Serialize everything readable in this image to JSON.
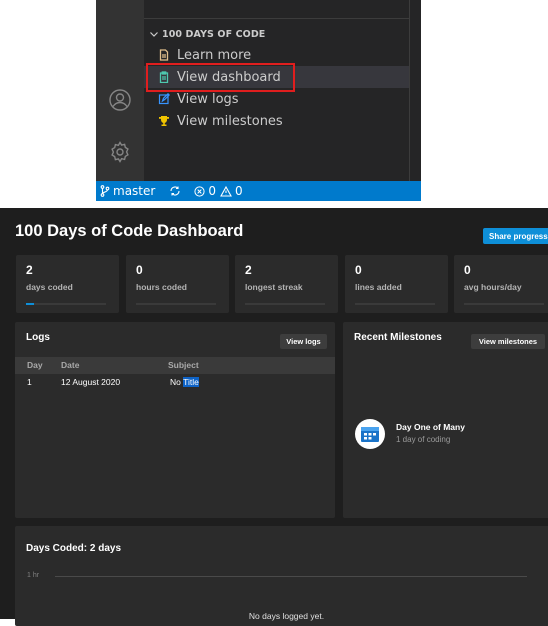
{
  "sidebar": {
    "section_title": "100 DAYS OF CODE",
    "items": [
      {
        "label": "Learn more",
        "icon": "document-icon"
      },
      {
        "label": "View dashboard",
        "icon": "clipboard-icon"
      },
      {
        "label": "View logs",
        "icon": "edit-icon"
      },
      {
        "label": "View milestones",
        "icon": "trophy-icon"
      }
    ]
  },
  "status_bar": {
    "branch": "master",
    "errors": "0",
    "warnings": "0"
  },
  "dashboard": {
    "title": "100 Days of Code Dashboard",
    "share_label": "Share progress",
    "stats": [
      {
        "value": "2",
        "label": "days coded",
        "progress": 0.02
      },
      {
        "value": "0",
        "label": "hours coded",
        "progress": 0
      },
      {
        "value": "2",
        "label": "longest streak",
        "progress": 0
      },
      {
        "value": "0",
        "label": "lines added",
        "progress": 0
      },
      {
        "value": "0",
        "label": "avg hours/day",
        "progress": 0
      }
    ],
    "logs": {
      "title": "Logs",
      "button": "View logs",
      "columns": [
        "Day",
        "Date",
        "Subject"
      ],
      "rows": [
        {
          "day": "1",
          "date": "12 August 2020",
          "subject_a": "No ",
          "subject_b": "Title"
        }
      ]
    },
    "milestones": {
      "title": "Recent Milestones",
      "button": "View milestones",
      "items": [
        {
          "name": "Day One of Many",
          "desc": "1 day of coding"
        }
      ]
    },
    "days_coded": {
      "title": "Days Coded: 2 days",
      "axis_label": "1 hr",
      "empty_message": "No days logged yet."
    }
  },
  "colors": {
    "accent": "#0e8fd8",
    "highlight": "#e01e1e",
    "status_bar": "#007acc"
  }
}
